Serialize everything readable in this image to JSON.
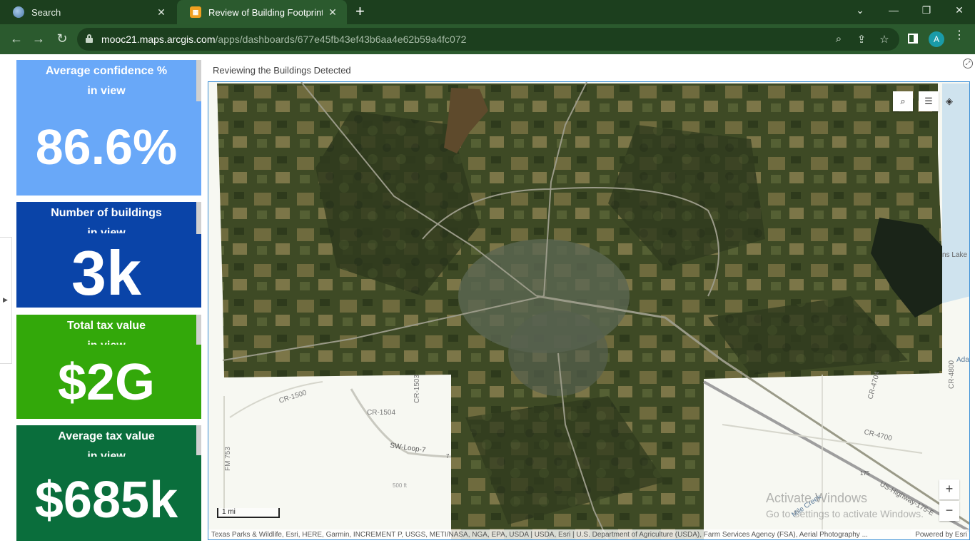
{
  "browser": {
    "tabs": [
      {
        "label": "Search",
        "icon": "globe-icon"
      },
      {
        "label": "Review of Building Footprint res",
        "icon": "arcgis-dashboard-icon"
      }
    ],
    "url_host": "mooc21.maps.arcgis.com",
    "url_path": "/apps/dashboards/677e45fb43ef43b6aa4e62b59a4fc072",
    "profile_initial": "A",
    "tab_close_glyph": "✕",
    "new_tab_glyph": "+"
  },
  "indicators": [
    {
      "title": "Average confidence %",
      "subtitle": "in view",
      "value": "86.6%",
      "color": "#69a8f8"
    },
    {
      "title": "Number of buildings",
      "subtitle": "in view",
      "value": "3k",
      "color": "#0a44a8"
    },
    {
      "title": "Total tax value",
      "subtitle": "in view",
      "value": "$2G",
      "color": "#33a80a"
    },
    {
      "title": "Average tax value",
      "subtitle": "in view",
      "value": "$685k",
      "color": "#0a6e3c"
    }
  ],
  "map": {
    "title": "Reviewing the Buildings Detected",
    "scale_label": "1 mi",
    "attribution": "Texas Parks & Wildlife, Esri, HERE, Garmin, INCREMENT P, USGS, METI/NASA, NGA, EPA, USDA | USDA, Esri | U.S. Department of Agriculture (USDA), Farm Services Agency (FSA), Aerial Photography ...",
    "powered_by": "Powered by Esri",
    "zoom_in": "+",
    "zoom_out": "−",
    "road_labels": [
      "CR-1500",
      "CR-1504",
      "CR-1503",
      "SW-Loop-7",
      "FM 753",
      "CR-4700",
      "CR-4704",
      "CR-4800",
      "US-Highway-175-E",
      "Mile Creek",
      "175",
      "7",
      "500 ft",
      "ns Lake",
      "Ada"
    ]
  },
  "os_watermark": {
    "line1": "Activate Windows",
    "line2": "Go to Settings to activate Windows."
  }
}
